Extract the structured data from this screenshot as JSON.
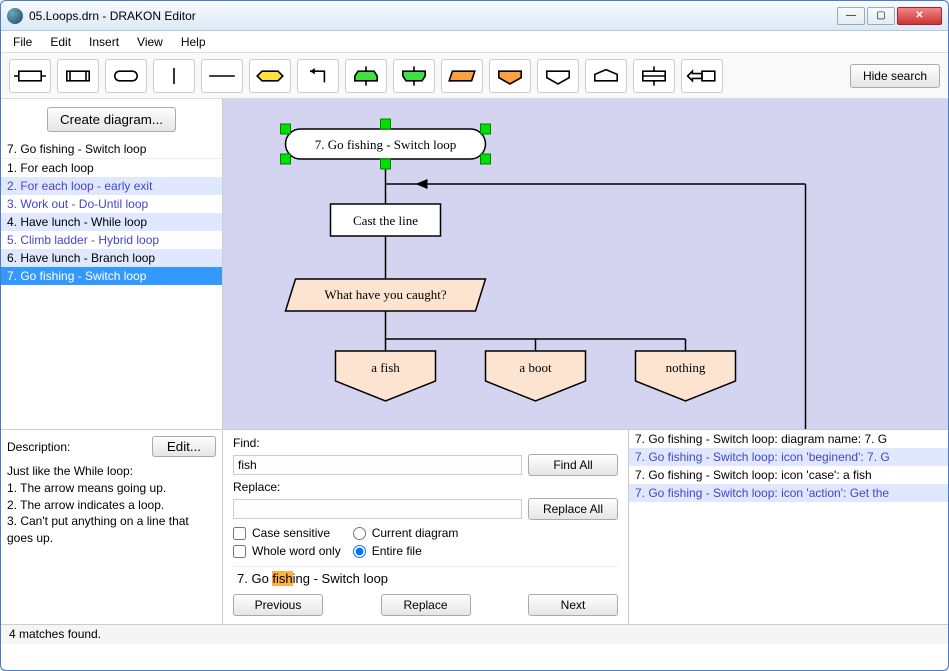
{
  "window": {
    "title": "05.Loops.drn - DRAKON Editor"
  },
  "menu": {
    "file": "File",
    "edit": "Edit",
    "insert": "Insert",
    "view": "View",
    "help": "Help"
  },
  "toolbar": {
    "hide_search": "Hide search"
  },
  "sidebar": {
    "create": "Create diagram...",
    "header": "7. Go fishing - Switch loop",
    "items": [
      "1. For each loop",
      "2. For each loop - early exit",
      "3. Work out - Do-Until loop",
      "4. Have lunch - While loop",
      "5. Climb ladder - Hybrid loop",
      "6. Have lunch - Branch loop",
      "7. Go fishing - Switch loop"
    ]
  },
  "diagram": {
    "title": "7. Go fishing - Switch loop",
    "action1": "Cast the line",
    "question": "What have you caught?",
    "case1": "a fish",
    "case2": "a boot",
    "case3": "nothing"
  },
  "description": {
    "label": "Description:",
    "edit": "Edit...",
    "text": "Just like the While loop:\n1. The arrow means going up.\n2. The arrow indicates a loop.\n3. Can't put anything on a line that goes up."
  },
  "find": {
    "find_label": "Find:",
    "find_value": "fish",
    "replace_label": "Replace:",
    "replace_value": "",
    "find_all": "Find All",
    "replace_all": "Replace All",
    "case_sensitive": "Case sensitive",
    "whole_word": "Whole word only",
    "current_diagram": "Current diagram",
    "entire_file": "Entire file",
    "preview_pre": "7. Go ",
    "preview_hl": "fish",
    "preview_post": "ing - Switch loop",
    "previous": "Previous",
    "replace": "Replace",
    "next": "Next"
  },
  "results": [
    "7. Go fishing - Switch loop: diagram name: 7. G",
    "7. Go fishing - Switch loop: icon 'beginend': 7. G",
    "7. Go fishing - Switch loop: icon 'case': a fish",
    "7. Go fishing - Switch loop: icon 'action': Get the"
  ],
  "status": "4 matches found."
}
